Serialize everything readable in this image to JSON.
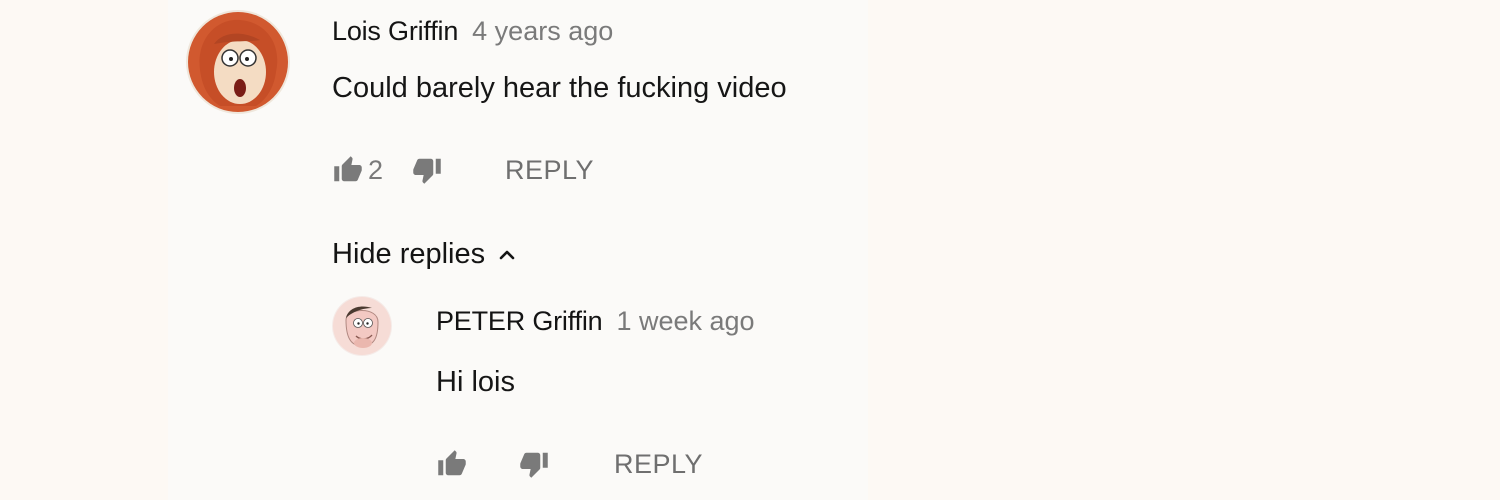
{
  "comments": [
    {
      "author": "Lois Griffin",
      "time": "4 years ago",
      "text": "Could barely hear the fucking video",
      "like_count": "2",
      "reply_label": "REPLY",
      "avatar_icon": "lois-avatar"
    }
  ],
  "replies_toggle": {
    "label": "Hide replies",
    "icon": "chevron-up-icon"
  },
  "replies": [
    {
      "author": "PETER Griffin",
      "time": "1 week ago",
      "text": "Hi lois",
      "like_count": "",
      "reply_label": "REPLY",
      "avatar_icon": "peter-avatar"
    }
  ],
  "colors": {
    "background": "#fdf9f4",
    "text": "#141414",
    "muted": "#7a7a7a",
    "lois_hair": "#c8542e",
    "peter_skin": "#f3c9c3"
  }
}
